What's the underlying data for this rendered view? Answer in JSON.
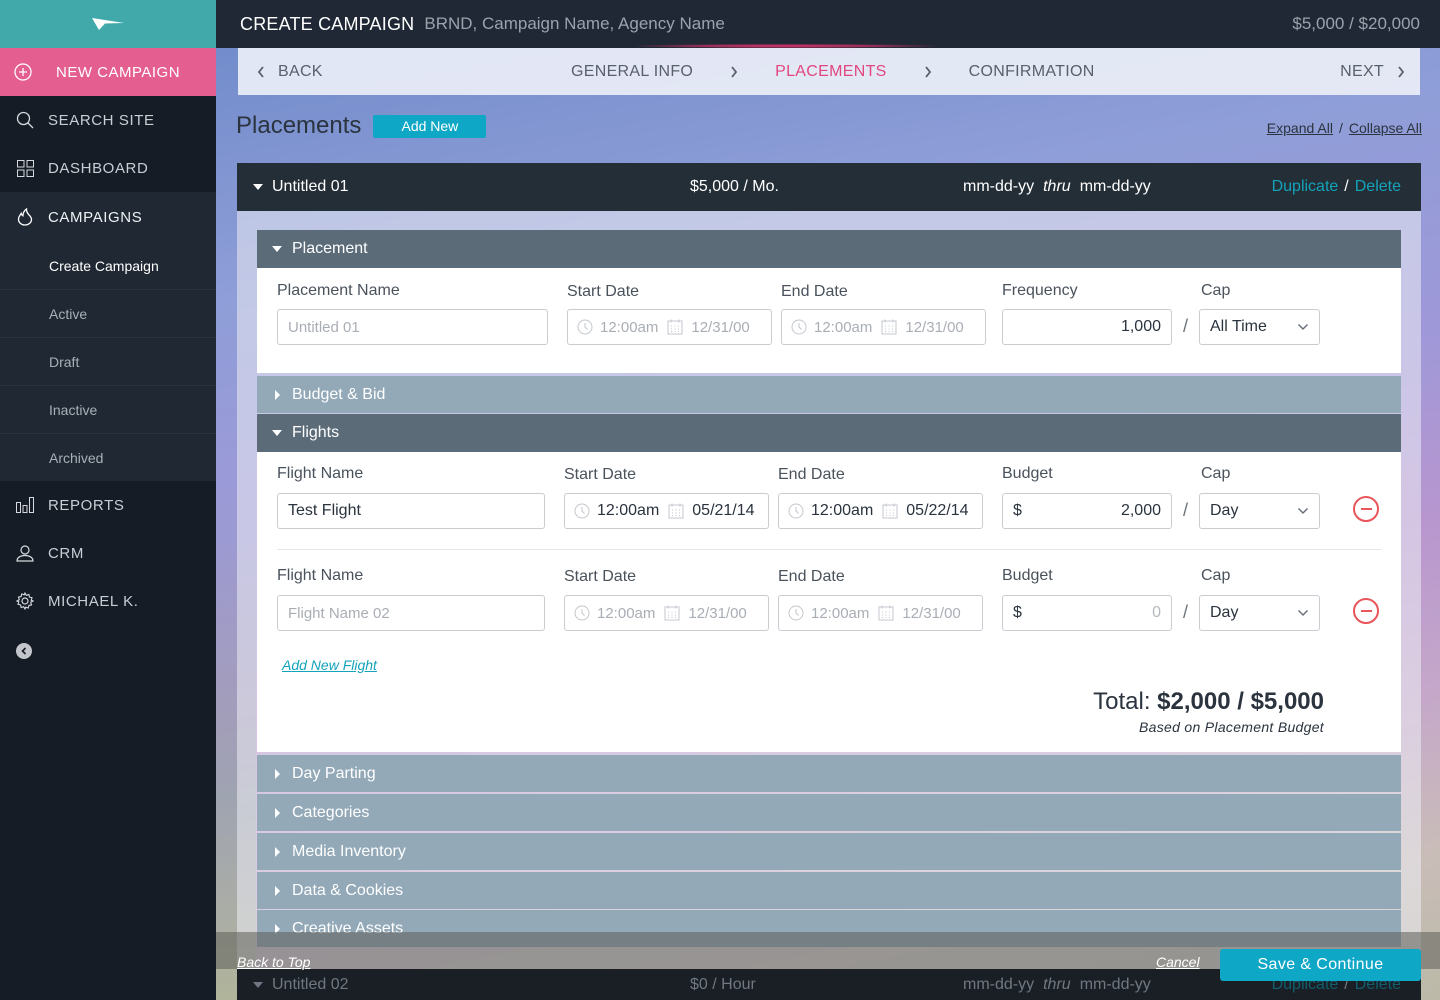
{
  "sidebar": {
    "logo": "paper-plane-logo",
    "new_campaign": "NEW CAMPAIGN",
    "items": [
      {
        "label": "SEARCH SITE",
        "icon": "search-icon"
      },
      {
        "label": "DASHBOARD",
        "icon": "grid-icon"
      },
      {
        "label": "CAMPAIGNS",
        "icon": "flame-icon"
      },
      {
        "label": "REPORTS",
        "icon": "bar-chart-icon"
      },
      {
        "label": "CRM",
        "icon": "users-icon"
      },
      {
        "label": "MICHAEL K.",
        "icon": "gear-icon"
      }
    ],
    "campaign_sub": [
      "Create Campaign",
      "Active",
      "Draft",
      "Inactive",
      "Archived"
    ]
  },
  "topbar": {
    "title": "CREATE CAMPAIGN",
    "subtitle": "BRND, Campaign Name, Agency Name",
    "budget": "$5,000 / $20,000"
  },
  "stepbar": {
    "back": "BACK",
    "steps": [
      "GENERAL INFO",
      "PLACEMENTS",
      "CONFIRMATION"
    ],
    "active_step": "PLACEMENTS",
    "next": "NEXT"
  },
  "page": {
    "title": "Placements",
    "add_new": "Add New",
    "expand_all": "Expand All",
    "collapse_all": "Collapse All",
    "sep": "/"
  },
  "placements": [
    {
      "name": "Untitled 01",
      "rate": "$5,000 / Mo.",
      "start": "mm-dd-yy",
      "thru": "thru",
      "end": "mm-dd-yy",
      "duplicate": "Duplicate",
      "delete": "Delete"
    },
    {
      "name": "Untitled 02",
      "rate": "$0 / Hour",
      "start": "mm-dd-yy",
      "thru": "thru",
      "end": "mm-dd-yy",
      "duplicate": "Duplicate",
      "delete": "Delete"
    }
  ],
  "placement_section": {
    "title": "Placement",
    "name_label": "Placement Name",
    "name_placeholder": "Untitled 01",
    "start_label": "Start Date",
    "start_time": "12:00am",
    "start_date": "12/31/00",
    "end_label": "End Date",
    "end_time": "12:00am",
    "end_date": "12/31/00",
    "frequency_label": "Frequency",
    "frequency_value": "1,000",
    "cap_label": "Cap",
    "cap_value": "All Time"
  },
  "sections": {
    "budget_bid": "Budget & Bid",
    "flights": "Flights",
    "day_parting": "Day Parting",
    "categories": "Categories",
    "media_inventory": "Media Inventory",
    "data_cookies": "Data & Cookies",
    "creative_assets": "Creative Assets"
  },
  "flights": [
    {
      "name_label": "Flight Name",
      "name_value": "Test Flight",
      "start_label": "Start Date",
      "start_time": "12:00am",
      "start_date": "05/21/14",
      "end_label": "End Date",
      "end_time": "12:00am",
      "end_date": "05/22/14",
      "budget_label": "Budget",
      "currency": "$",
      "budget_value": "2,000",
      "cap_label": "Cap",
      "cap_value": "Day"
    },
    {
      "name_label": "Flight Name",
      "name_placeholder": "Flight Name 02",
      "start_label": "Start Date",
      "start_time": "12:00am",
      "start_date": "12/31/00",
      "end_label": "End Date",
      "end_time": "12:00am",
      "end_date": "12/31/00",
      "budget_label": "Budget",
      "currency": "$",
      "budget_placeholder": "0",
      "cap_label": "Cap",
      "cap_value": "Day"
    }
  ],
  "flights_footer": {
    "add_new_flight": "Add New Flight",
    "total_label": "Total:",
    "total_value": "$2,000 / $5,000",
    "note": "Based on Placement Budget"
  },
  "footer": {
    "back_to_top": "Back to Top",
    "cancel": "Cancel",
    "save": "Save & Continue"
  },
  "colors": {
    "accent_teal": "#0fa7c6",
    "accent_pink": "#e45e8f",
    "danger": "#e8555a",
    "sidebar_bg": "#151c25"
  }
}
